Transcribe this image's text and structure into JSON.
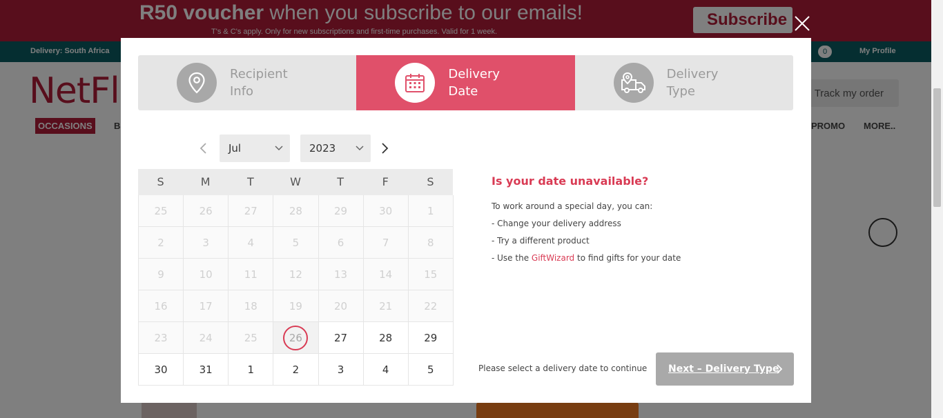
{
  "promo": {
    "headline_bold": "R50 voucher",
    "headline_rest": " when you subscribe to our emails!",
    "fine_print": "T's & C's apply. Only for new subscriptions and first-time purchases. Valid for 1 week.",
    "subscribe_label": "Subscribe"
  },
  "info_bar": {
    "delivery_label": "Delivery: South Africa",
    "cart_count": "0",
    "profile_label": "My Profile"
  },
  "header": {
    "logo": "NetFl",
    "track_order_label": "Track my order"
  },
  "nav": {
    "occasions": "OCCASIONS",
    "b_item": "B",
    "promo": "PROMO",
    "more": "MORE.."
  },
  "modal": {
    "steps": [
      {
        "line1": "Recipient",
        "line2": "Info",
        "icon": "location-pin-icon",
        "active": false
      },
      {
        "line1": "Delivery",
        "line2": "Date",
        "icon": "calendar-icon",
        "active": true
      },
      {
        "line1": "Delivery",
        "line2": "Type",
        "icon": "delivery-truck-icon",
        "active": false
      }
    ],
    "month": "Jul",
    "year": "2023",
    "weekdays": [
      "S",
      "M",
      "T",
      "W",
      "T",
      "F",
      "S"
    ],
    "days": [
      {
        "label": "25",
        "state": "disabled"
      },
      {
        "label": "26",
        "state": "disabled"
      },
      {
        "label": "27",
        "state": "disabled"
      },
      {
        "label": "28",
        "state": "disabled"
      },
      {
        "label": "29",
        "state": "disabled"
      },
      {
        "label": "30",
        "state": "disabled"
      },
      {
        "label": "1",
        "state": "disabled"
      },
      {
        "label": "2",
        "state": "disabled"
      },
      {
        "label": "3",
        "state": "disabled"
      },
      {
        "label": "4",
        "state": "disabled"
      },
      {
        "label": "5",
        "state": "disabled"
      },
      {
        "label": "6",
        "state": "disabled"
      },
      {
        "label": "7",
        "state": "disabled"
      },
      {
        "label": "8",
        "state": "disabled"
      },
      {
        "label": "9",
        "state": "disabled"
      },
      {
        "label": "10",
        "state": "disabled"
      },
      {
        "label": "11",
        "state": "disabled"
      },
      {
        "label": "12",
        "state": "disabled"
      },
      {
        "label": "13",
        "state": "disabled"
      },
      {
        "label": "14",
        "state": "disabled"
      },
      {
        "label": "15",
        "state": "disabled"
      },
      {
        "label": "16",
        "state": "disabled"
      },
      {
        "label": "17",
        "state": "disabled"
      },
      {
        "label": "18",
        "state": "disabled"
      },
      {
        "label": "19",
        "state": "disabled"
      },
      {
        "label": "20",
        "state": "disabled"
      },
      {
        "label": "21",
        "state": "disabled"
      },
      {
        "label": "22",
        "state": "disabled"
      },
      {
        "label": "23",
        "state": "disabled"
      },
      {
        "label": "24",
        "state": "disabled"
      },
      {
        "label": "25",
        "state": "disabled"
      },
      {
        "label": "26",
        "state": "today"
      },
      {
        "label": "27",
        "state": "available"
      },
      {
        "label": "28",
        "state": "available"
      },
      {
        "label": "29",
        "state": "available"
      },
      {
        "label": "30",
        "state": "available"
      },
      {
        "label": "31",
        "state": "available"
      },
      {
        "label": "1",
        "state": "available"
      },
      {
        "label": "2",
        "state": "available"
      },
      {
        "label": "3",
        "state": "available"
      },
      {
        "label": "4",
        "state": "available"
      },
      {
        "label": "5",
        "state": "available"
      }
    ],
    "side": {
      "title": "Is your date unavailable?",
      "intro": "To work around a special day, you can:",
      "line1": "- Change your delivery address",
      "line2": "- Try a different product",
      "line3_pre": "- Use the ",
      "line3_link": "GiftWizard",
      "line3_post": " to find gifts for your date"
    },
    "select_message": "Please select a delivery date to continue",
    "next_label": "Next – Delivery Type"
  },
  "colors": {
    "brand": "#b01c38",
    "accent": "#e0506a",
    "teal": "#0b5c62",
    "button_disabled": "#a9a9a9"
  }
}
